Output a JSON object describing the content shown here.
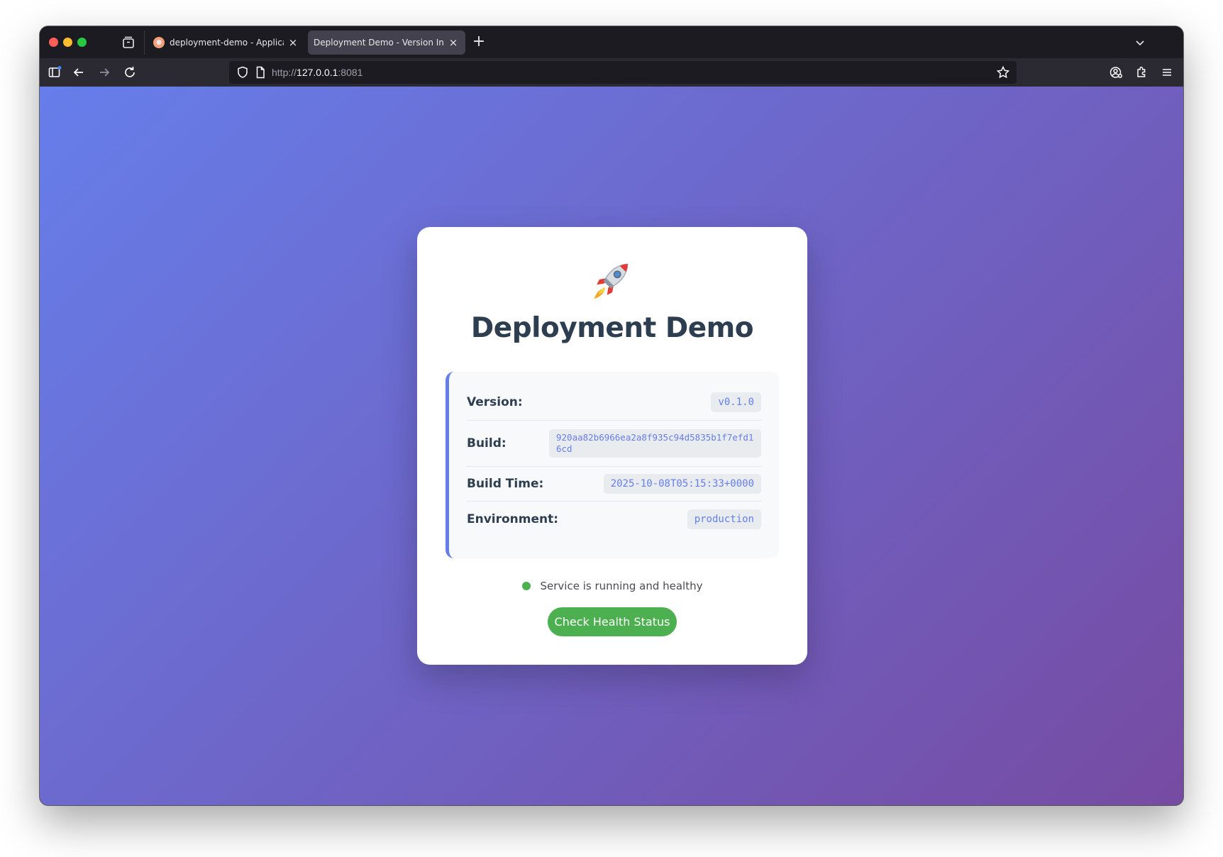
{
  "browser": {
    "tabs": [
      {
        "title": "deployment-demo - Application",
        "active": false
      },
      {
        "title": "Deployment Demo - Version Info",
        "active": true
      }
    ],
    "close_glyph": "×",
    "new_tab_glyph": "+",
    "url": {
      "scheme": "http://",
      "host": "127.0.0.1",
      "port": ":8081"
    },
    "icons": [
      "sidebar-icon",
      "back-icon",
      "forward-icon",
      "reload-icon",
      "shield-icon",
      "page-icon",
      "bookmark-star-icon",
      "account-icon",
      "extensions-icon",
      "menu-icon"
    ]
  },
  "page": {
    "emoji": "🚀",
    "title": "Deployment Demo",
    "info": {
      "version_label": "Version:",
      "version_value": "v0.1.0",
      "build_label": "Build:",
      "build_value": "920aa82b6966ea2a8f935c94d5835b1f7efd16cd",
      "build_time_label": "Build Time:",
      "build_time_value": "2025-10-08T05:15:33+0000",
      "environment_label": "Environment:",
      "environment_value": "production"
    },
    "status_text": "Service is running and healthy",
    "health_button": "Check Health Status"
  },
  "colors": {
    "gradient_start": "#667eea",
    "gradient_end": "#764ba2",
    "accent": "#667eea",
    "status_green": "#4caf50",
    "heading": "#2c3e50"
  }
}
